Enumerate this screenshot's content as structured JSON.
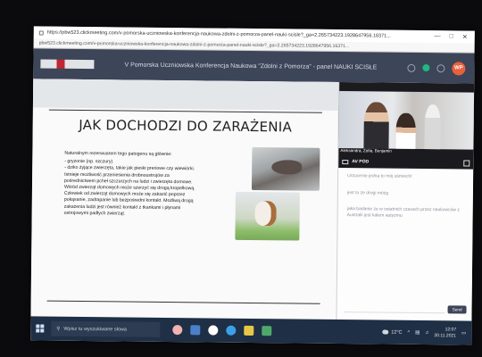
{
  "browser": {
    "title_url": "https://pbw523.clickmeeting.com/v-pomorska-uczniowska-konferencja-naukowa-zdolni-z-pomorza-panel-nauki-scisle?_ga=2.265734223.1928647956.16371...",
    "address_url": "pbw523.clickmeeting.com/v-pomorska-uczniowska-konferencja-naukowa-zdolni-z-pomorza-panel-nauki-scisle?_ga=2.265734223.1928647956.16371...",
    "controls": [
      "—",
      "□",
      "✕"
    ]
  },
  "app": {
    "title": "V Pomorska Uczniowska Konferencja Naukowa \"Zdolni z Pomorza\" - panel NAUKI ŚCISŁE",
    "user_initials": "WP",
    "accent": "#3d4558"
  },
  "slide": {
    "title": "JAK DOCHODZI DO ZARAŻENIA",
    "lines": [
      "Naturalnym rezerwuarem tego patogenu są głównie:",
      "- gryzonie (np. szczury)",
      "- dziko żyjące zwierzęta, takie jak pieski preriowe czy wiewiórki.",
      "Istnieje możliwość przeniesienia drobnoustrojów za",
      "pośrednictwem pcheł szczurzych na ludzi i zwierzęta domowe.",
      "Wśród zwierząt domowych może szerzyć się drogą kropelkową.",
      "Człowiek od zwierząt domowych może się zakazić poprzez",
      "pokąsanie, zadrapanie lub bezpośredni kontakt. Możliwą drogą",
      "zakażenia ludzi jest również kontakt z tkankami i płynami",
      "ustrojowymi padłych zwierząt."
    ]
  },
  "video": {
    "participant_names": "Aleksandra, Zofia, Benjamin",
    "source_label": "AV POD"
  },
  "chat": {
    "messages": [
      {
        "who": "",
        "text": "Urzucenie jedna to mój uśmiech!"
      },
      {
        "who": "",
        "text": "jest to ze drogi mózg"
      },
      {
        "who": "",
        "text": "jaka badanie ze w ostatnich czasach przez naukowców z Australii jest kalem autyzmu"
      }
    ],
    "send_label": "Send"
  },
  "taskbar": {
    "search_placeholder": "Wpisz tu wyszukiwane słowa",
    "temperature": "12°C",
    "time": "12:07",
    "date": "20.11.2021",
    "icon_colors": [
      "#f2b2b2",
      "#4a7fc9",
      "#ffffff",
      "#3aa0e8",
      "#e9c646",
      "#4fa86a"
    ]
  }
}
